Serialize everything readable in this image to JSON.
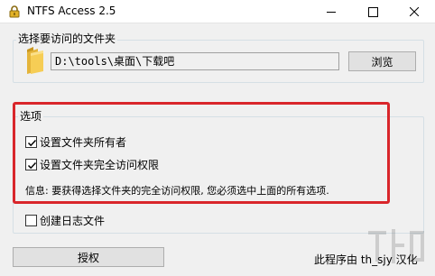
{
  "window": {
    "title": "NTFS Access 2.5"
  },
  "folder_group": {
    "label": "选择要访问的文件夹",
    "path_value": "D:\\tools\\桌面\\下载吧",
    "browse_label": "浏览"
  },
  "options_group": {
    "label": "选项",
    "set_owner": {
      "label": "设置文件夹所有者",
      "checked": true
    },
    "set_full_access": {
      "label": "设置文件夹完全访问权限",
      "checked": true
    },
    "info": "信息: 要获得选择文件夹的完全访问权限, 您必须选中上面的所有选项."
  },
  "create_log": {
    "label": "创建日志文件",
    "checked": false
  },
  "grant_button": "授权",
  "credit": "此程序由 th_sjy 汉化",
  "colors": {
    "highlight_border": "#d9262b",
    "window_bg": "#f0f0f0"
  },
  "icons": {
    "app": "lock-icon",
    "folder": "folder-icon"
  }
}
